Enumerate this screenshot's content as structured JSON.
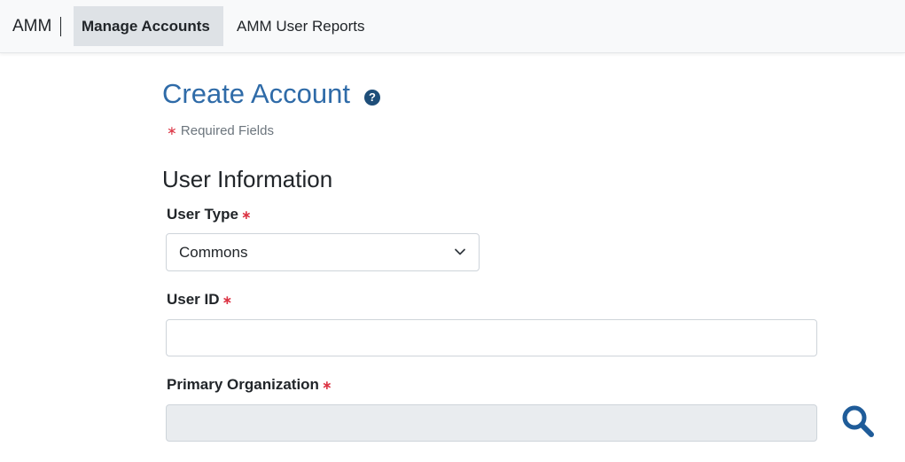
{
  "navbar": {
    "brand": "AMM",
    "items": [
      {
        "label": "Manage Accounts",
        "active": true
      },
      {
        "label": "AMM User Reports",
        "active": false
      }
    ]
  },
  "page": {
    "title": "Create Account",
    "help_icon": "question-circle-icon",
    "required_asterisk": "∗",
    "required_note": "Required Fields"
  },
  "section": {
    "title": "User Information"
  },
  "form": {
    "user_type": {
      "label": "User Type",
      "asterisk": "∗",
      "value": "Commons"
    },
    "user_id": {
      "label": "User ID",
      "asterisk": "∗",
      "value": "",
      "placeholder": ""
    },
    "primary_org": {
      "label": "Primary Organization",
      "asterisk": "∗",
      "value": "",
      "placeholder": ""
    },
    "search_icon": "search-icon"
  },
  "colors": {
    "title_blue": "#2f6ba8",
    "icon_blue": "#1e4e79",
    "required_red": "#dc3545",
    "nav_active_bg": "#dee2e6",
    "disabled_field_bg": "#e9ecef"
  }
}
